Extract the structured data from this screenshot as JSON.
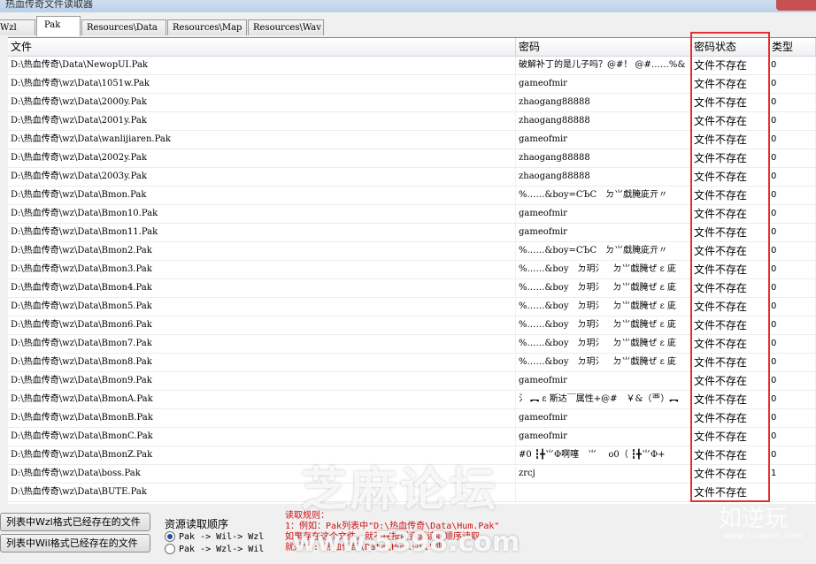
{
  "window": {
    "title": "热血传奇文件读取器"
  },
  "tabs": [
    {
      "label": "Wzl"
    },
    {
      "label": "Pak"
    },
    {
      "label": "Resources\\Data"
    },
    {
      "label": "Resources\\Map"
    },
    {
      "label": "Resources\\Wav"
    }
  ],
  "table": {
    "columns": [
      "文件",
      "密码",
      "密码状态",
      "类型"
    ],
    "rows": [
      {
        "file": "D:\\热血传奇\\Data\\NewopUI.Pak",
        "password": "破解补丁的是儿子吗？@#！ @#……%&",
        "status": "文件不存在",
        "type": "0"
      },
      {
        "file": "D:\\热血传奇\\wz\\Data\\1051w.Pak",
        "password": "gameofmir",
        "status": "文件不存在",
        "type": "0"
      },
      {
        "file": "D:\\热血传奇\\wz\\Data\\2000y.Pak",
        "password": "zhaogang88888",
        "status": "文件不存在",
        "type": "0"
      },
      {
        "file": "D:\\热血传奇\\wz\\Data\\2001y.Pak",
        "password": "zhaogang88888",
        "status": "文件不存在",
        "type": "0"
      },
      {
        "file": "D:\\热血传奇\\wz\\Data\\wanlijiaren.Pak",
        "password": "gameofmir",
        "status": "文件不存在",
        "type": "0"
      },
      {
        "file": "D:\\热血传奇\\wz\\Data\\2002y.Pak",
        "password": "zhaogang88888",
        "status": "文件不存在",
        "type": "0"
      },
      {
        "file": "D:\\热血传奇\\wz\\Data\\2003y.Pak",
        "password": "zhaogang88888",
        "status": "文件不存在",
        "type": "0"
      },
      {
        "file": "D:\\热血传奇\\wz\\Data\\Bmon.Pak",
        "password": "%……&boy=CЪC　ㄉ⺌戱腌庛亓〃",
        "status": "文件不存在",
        "type": "0"
      },
      {
        "file": "D:\\热血传奇\\wz\\Data\\Bmon10.Pak",
        "password": "gameofmir",
        "status": "文件不存在",
        "type": "0"
      },
      {
        "file": "D:\\热血传奇\\wz\\Data\\Bmon11.Pak",
        "password": "gameofmir",
        "status": "文件不存在",
        "type": "0"
      },
      {
        "file": "D:\\热血传奇\\wz\\Data\\Bmon2.Pak",
        "password": "%……&boy=CЪC　ㄉ⺌戱腌庛亓〃",
        "status": "文件不存在",
        "type": "0"
      },
      {
        "file": "D:\\热血传奇\\wz\\Data\\Bmon3.Pak",
        "password": "%……&boy　ㄉ玥氵　ㄉ⺌戱腌ぜ ε 庛",
        "status": "文件不存在",
        "type": "0"
      },
      {
        "file": "D:\\热血传奇\\wz\\Data\\Bmon4.Pak",
        "password": "%……&boy　ㄉ玥氵　ㄉ⺌戱腌ぜ ε 庛",
        "status": "文件不存在",
        "type": "0"
      },
      {
        "file": "D:\\热血传奇\\wz\\Data\\Bmon5.Pak",
        "password": "%……&boy　ㄉ玥氵　ㄉ⺌戱腌ぜ ε 庛",
        "status": "文件不存在",
        "type": "0"
      },
      {
        "file": "D:\\热血传奇\\wz\\Data\\Bmon6.Pak",
        "password": "%……&boy　ㄉ玥氵　ㄉ⺌戱腌ぜ ε 庛",
        "status": "文件不存在",
        "type": "0"
      },
      {
        "file": "D:\\热血传奇\\wz\\Data\\Bmon7.Pak",
        "password": "%……&boy　ㄉ玥氵　ㄉ⺌戱腌ぜ ε 庛",
        "status": "文件不存在",
        "type": "0"
      },
      {
        "file": "D:\\热血传奇\\wz\\Data\\Bmon8.Pak",
        "password": "%……&boy　ㄉ玥氵　ㄉ⺌戱腌ぜ ε 庛",
        "status": "文件不存在",
        "type": "0"
      },
      {
        "file": "D:\\热血传奇\\wz\\Data\\Bmon9.Pak",
        "password": "gameofmir",
        "status": "文件不存在",
        "type": "0"
      },
      {
        "file": "D:\\热血传奇\\wz\\Data\\BmonA.Pak",
        "password": "氵 ︻ ε 斯达￣属性+@#　￥&（覀）︻",
        "status": "文件不存在",
        "type": "0"
      },
      {
        "file": "D:\\热血传奇\\wz\\Data\\BmonB.Pak",
        "password": "gameofmir",
        "status": "文件不存在",
        "type": "0"
      },
      {
        "file": "D:\\热血传奇\\wz\\Data\\BmonC.Pak",
        "password": "gameofmir",
        "status": "文件不存在",
        "type": "0"
      },
      {
        "file": "D:\\热血传奇\\wz\\Data\\BmonZ.Pak",
        "password": "#0 ┇╋⺌Φ啊噻　⺌　 o0（ ┇╋⺌Φ+",
        "status": "文件不存在",
        "type": "0"
      },
      {
        "file": "D:\\热血传奇\\wz\\Data\\boss.Pak",
        "password": "zrcj",
        "status": "文件不存在",
        "type": "1"
      },
      {
        "file": "D:\\热血传奇\\wz\\Data\\BUTE.Pak",
        "password": "",
        "status": "文件不存在",
        "type": ""
      }
    ]
  },
  "bottom": {
    "btn_wzl": "列表中Wzl格式已经存在的文件",
    "btn_wil": "列表中Wil格式已经存在的文件",
    "read_order_title": "资源读取顺序",
    "radio1": "Pak -> Wil-> Wzl",
    "radio2": "Pak -> Wzl-> Wil",
    "rules_title": "读取规则：",
    "rules_line1": "1：例如：Pak列表中\"D:\\热血传奇\\Data\\Hum.Pak\"",
    "rules_line2": "如果存在这个文件，就不在按照资源读取顺序读取",
    "rules_line3": "就是\"D:\\热血传奇\\Data\\Hum.wil\"或"
  },
  "watermarks": {
    "forum": "芝麻论坛",
    "url": "www.5398.com",
    "right": "如逆玩",
    "right_sub": "www.ruciwan.com"
  },
  "colors": {
    "highlight_box": "#e03030",
    "rules_text": "#cc1111"
  }
}
